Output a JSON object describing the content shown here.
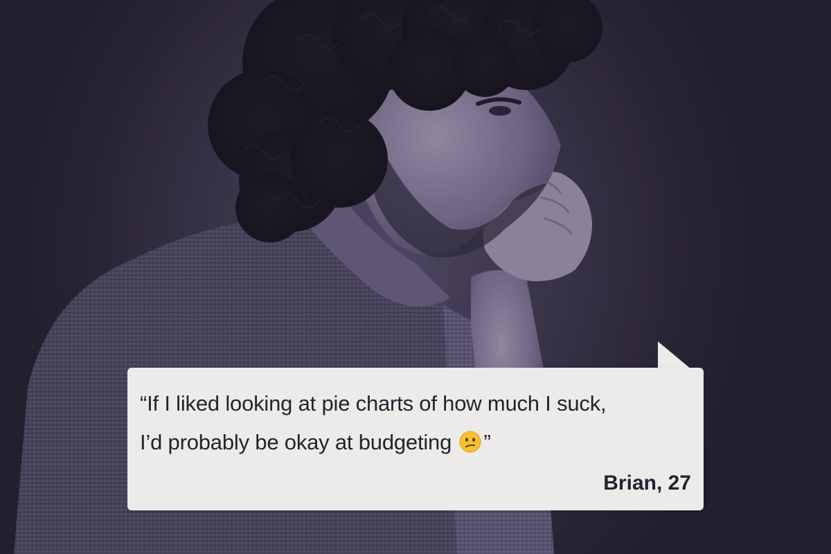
{
  "testimonial": {
    "quote_line_1": "“If I liked looking at pie charts of how much I suck,",
    "quote_line_2_text": "I’d probably be okay at budgeting",
    "quote_close": "”",
    "emoji": "confused-face-emoji",
    "author": "Brian, 27"
  },
  "colors": {
    "background": "#2b2638",
    "bubble": "#edebe9",
    "text": "#252230",
    "emoji_yellow": "#f5c033"
  },
  "photo": {
    "subject": "pensive-man-photo"
  }
}
